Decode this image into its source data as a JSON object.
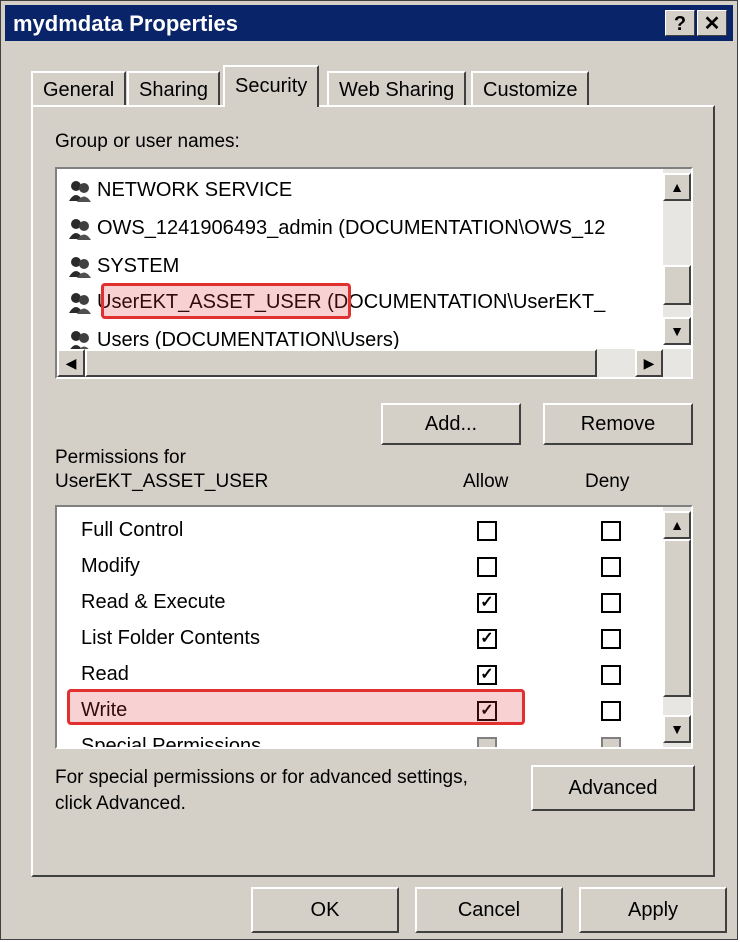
{
  "window": {
    "title": "mydmdata Properties",
    "help_label": "?",
    "close_label": "✕"
  },
  "tabs": [
    {
      "label": "General"
    },
    {
      "label": "Sharing"
    },
    {
      "label": "Security"
    },
    {
      "label": "Web Sharing"
    },
    {
      "label": "Customize"
    }
  ],
  "users": {
    "label": "Group or user names:",
    "items": [
      {
        "label": "NETWORK SERVICE"
      },
      {
        "label": "OWS_1241906493_admin (DOCUMENTATION\\OWS_12"
      },
      {
        "label": "SYSTEM"
      },
      {
        "label": "UserEKT_ASSET_USER (DOCUMENTATION\\UserEKT_"
      },
      {
        "label": "Users (DOCUMENTATION\\Users)"
      }
    ],
    "add_label": "Add...",
    "remove_label": "Remove"
  },
  "permissions": {
    "label_line1": "Permissions for",
    "label_line2": "UserEKT_ASSET_USER",
    "allow_label": "Allow",
    "deny_label": "Deny",
    "items": [
      {
        "name": "Full Control",
        "allow": false,
        "deny": false
      },
      {
        "name": "Modify",
        "allow": false,
        "deny": false
      },
      {
        "name": "Read & Execute",
        "allow": true,
        "deny": false
      },
      {
        "name": "List Folder Contents",
        "allow": true,
        "deny": false
      },
      {
        "name": "Read",
        "allow": true,
        "deny": false
      },
      {
        "name": "Write",
        "allow": true,
        "deny": false
      },
      {
        "name": "Special Permissions",
        "allow": false,
        "deny": false
      }
    ]
  },
  "advanced": {
    "text_line1": "For special permissions or for advanced settings,",
    "text_line2": "click Advanced.",
    "button_label": "Advanced"
  },
  "footer": {
    "ok_label": "OK",
    "cancel_label": "Cancel",
    "apply_label": "Apply"
  },
  "colors": {
    "title_bar": "#0a246a",
    "dialog_bg": "#d4d0c8",
    "highlight": "#e03030"
  }
}
